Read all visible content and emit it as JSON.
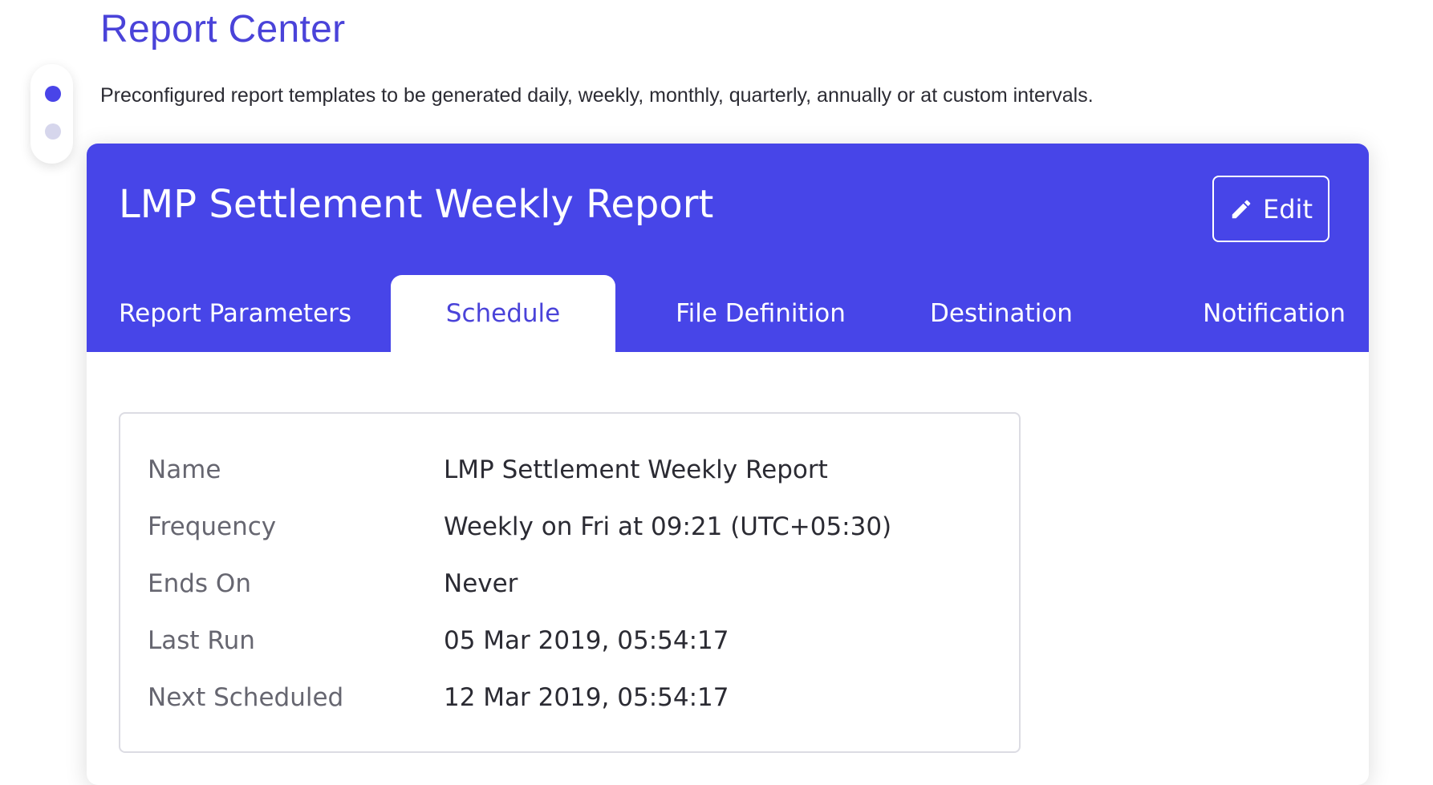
{
  "header": {
    "title": "Report Center",
    "subtitle": "Preconfigured report templates to be generated daily, weekly, monthly, quarterly, annually or at custom intervals."
  },
  "stepper": {
    "active_step": 1,
    "total_steps": 2
  },
  "report": {
    "title": "LMP Settlement Weekly Report",
    "edit_label": "Edit"
  },
  "tabs": [
    {
      "label": "Report Parameters",
      "active": false
    },
    {
      "label": "Schedule",
      "active": true
    },
    {
      "label": "File Definition",
      "active": false
    },
    {
      "label": "Destination",
      "active": false
    },
    {
      "label": "Notification",
      "active": false
    }
  ],
  "schedule": {
    "rows": [
      {
        "label": "Name",
        "value": "LMP Settlement Weekly Report"
      },
      {
        "label": "Frequency",
        "value": "Weekly on Fri at 09:21 (UTC+05:30)"
      },
      {
        "label": "Ends On",
        "value": "Never"
      },
      {
        "label": "Last Run",
        "value": "05 Mar 2019, 05:54:17"
      },
      {
        "label": "Next Scheduled",
        "value": "12 Mar 2019, 05:54:17"
      }
    ]
  },
  "colors": {
    "accent": "#4745e8",
    "title": "#4a43d9",
    "inactive_dot": "#d6d6ec"
  },
  "icons": {
    "edit": "pencil-icon"
  }
}
